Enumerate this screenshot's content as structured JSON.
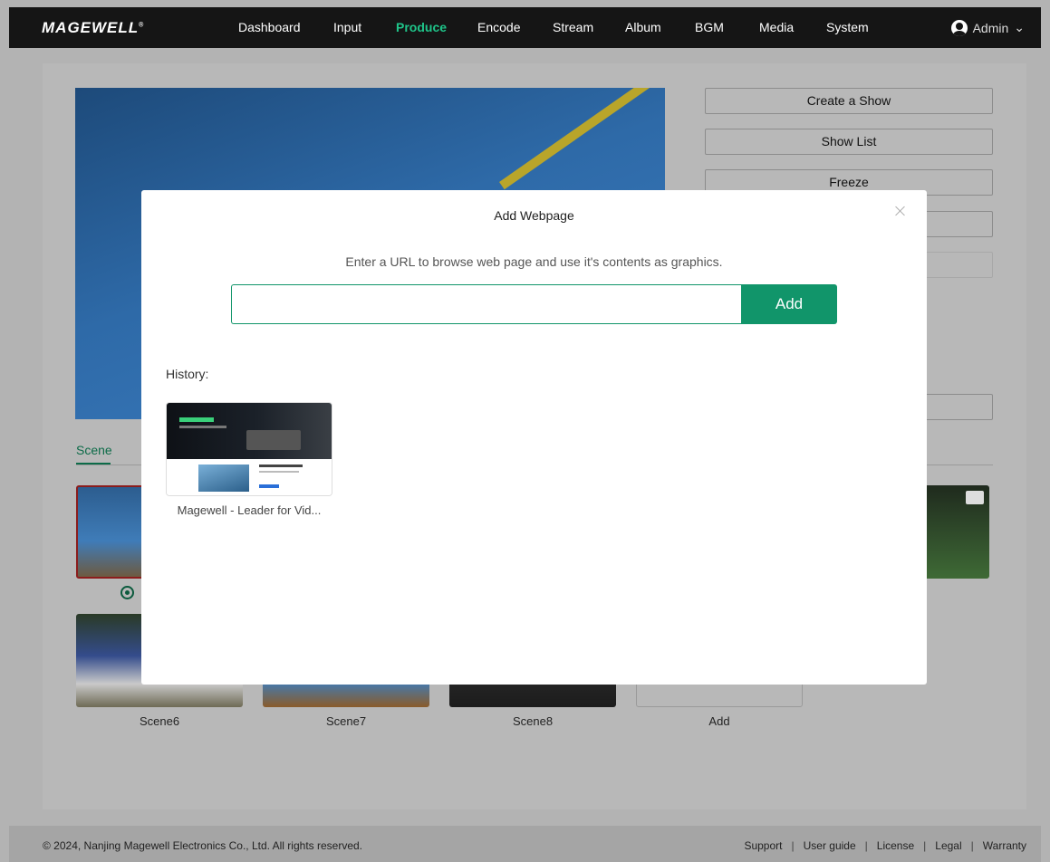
{
  "brand": {
    "logo": "MAGEWELL"
  },
  "nav": {
    "items": [
      "Dashboard",
      "Input",
      "Produce",
      "Encode",
      "Stream",
      "Album",
      "BGM",
      "Media",
      "System"
    ],
    "active": "Produce"
  },
  "user": {
    "name": "Admin"
  },
  "side_buttons": {
    "create_show": "Create a Show",
    "show_list": "Show List",
    "freeze": "Freeze"
  },
  "tabs": {
    "scene": "Scene"
  },
  "scenes": [
    "Scene6",
    "Scene7",
    "Scene8",
    "Add"
  ],
  "footer": {
    "copyright": "© 2024, Nanjing Magewell Electronics Co., Ltd. All rights reserved.",
    "links": [
      "Support",
      "User guide",
      "License",
      "Legal",
      "Warranty"
    ]
  },
  "modal": {
    "title": "Add Webpage",
    "description": "Enter a URL to browse web page and use it's contents as graphics.",
    "url_value": "",
    "add_label": "Add",
    "history_label": "History:",
    "history_items": [
      "Magewell - Leader for Vid..."
    ]
  }
}
